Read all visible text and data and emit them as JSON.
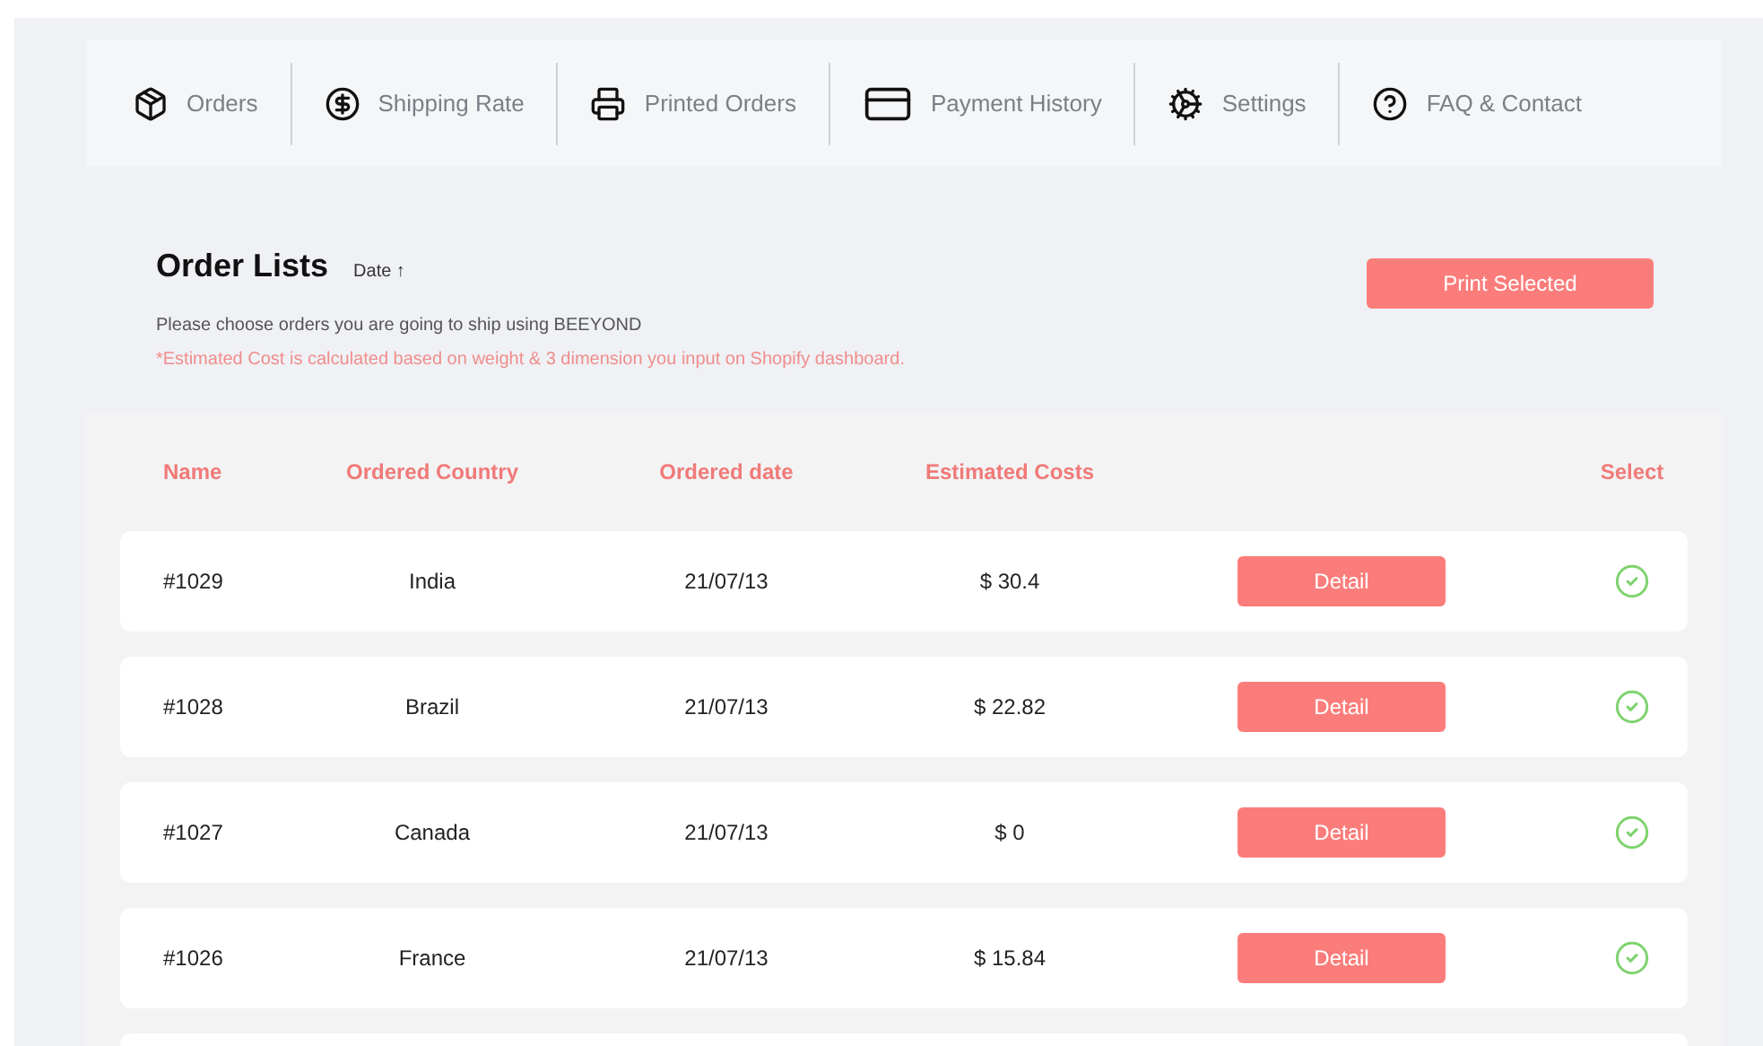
{
  "nav": [
    {
      "label": "Orders",
      "kind": "box"
    },
    {
      "label": "Shipping Rate",
      "kind": "dollar"
    },
    {
      "label": "Printed Orders",
      "kind": "printer"
    },
    {
      "label": "Payment History",
      "kind": "card"
    },
    {
      "label": "Settings",
      "kind": "gears"
    },
    {
      "label": "FAQ & Contact",
      "kind": "help"
    }
  ],
  "header": {
    "title": "Order Lists",
    "sort": "Date ↑",
    "instruction": "Please choose orders you are going to ship using BEEYOND",
    "note": "*Estimated Cost is calculated based on weight & 3 dimension you input on Shopify dashboard.",
    "print_button": "Print Selected"
  },
  "table": {
    "columns": [
      "Name",
      "Ordered Country",
      "Ordered date",
      "Estimated Costs",
      "Select"
    ],
    "rows": [
      {
        "name": "#1029",
        "country": "India",
        "date": "21/07/13",
        "cost": "$ 30.4",
        "action": "Detail",
        "selected": true
      },
      {
        "name": "#1028",
        "country": "Brazil",
        "date": "21/07/13",
        "cost": "$ 22.82",
        "action": "Detail",
        "selected": true
      },
      {
        "name": "#1027",
        "country": "Canada",
        "date": "21/07/13",
        "cost": "$ 0",
        "action": "Detail",
        "selected": true
      },
      {
        "name": "#1026",
        "country": "France",
        "date": "21/07/13",
        "cost": "$ 15.84",
        "action": "Detail",
        "selected": true
      }
    ]
  }
}
